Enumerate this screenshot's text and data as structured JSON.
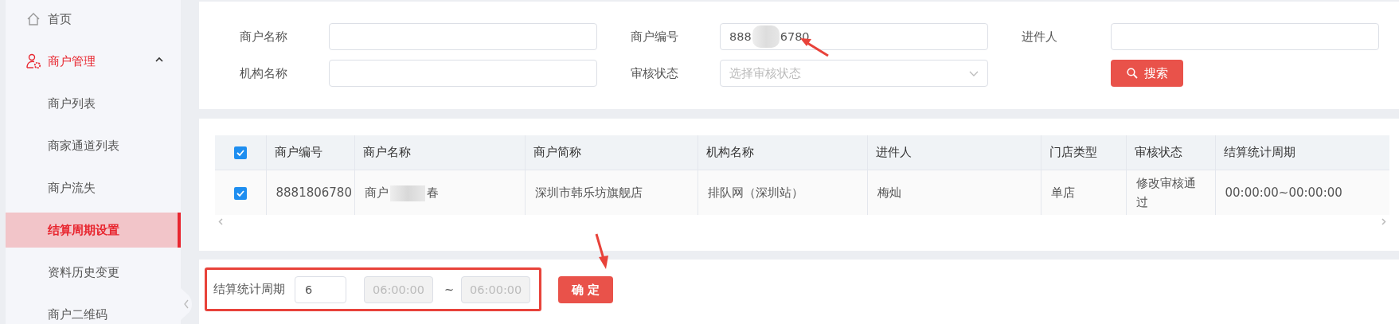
{
  "sidebar": {
    "items": [
      {
        "kind": "link",
        "label": "首页",
        "active": false
      },
      {
        "kind": "group",
        "label": "商户管理",
        "active": true,
        "expanded": true,
        "children": [
          {
            "label": "商户列表",
            "selected": false
          },
          {
            "label": "商家通道列表",
            "selected": false
          },
          {
            "label": "商户流失",
            "selected": false
          },
          {
            "label": "结算周期设置",
            "selected": true
          },
          {
            "label": "资料历史变更",
            "selected": false
          },
          {
            "label": "商户二维码",
            "selected": false
          }
        ]
      }
    ]
  },
  "search_form": {
    "fields": [
      {
        "kind": "text",
        "label": "商户名称"
      },
      {
        "kind": "text",
        "label": "商户编号",
        "value_parts": [
          "888",
          "6780"
        ]
      },
      {
        "kind": "text",
        "label": "进件人"
      },
      {
        "kind": "text",
        "label": "机构名称"
      },
      {
        "kind": "select",
        "label": "审核状态",
        "placeholder": "选择审核状态"
      },
      {
        "kind": "button",
        "label": "搜索"
      }
    ]
  },
  "table": {
    "all_checked": true,
    "columns": [
      "商户编号",
      "商户名称",
      "商户简称",
      "机构名称",
      "进件人",
      "门店类型",
      "审核状态",
      "结算统计周期"
    ],
    "rows": [
      {
        "checked": true,
        "cells": [
          "8881806780",
          [
            "商户",
            "春"
          ],
          "深圳市韩乐坊旗舰店",
          "排队网（深圳站）",
          "梅灿",
          "单店",
          "修改审核通过",
          "00:00:00~00:00:00"
        ]
      }
    ]
  },
  "period_form": {
    "label": "结算统计周期",
    "value": "6",
    "start": "06:00:00",
    "separator": "~",
    "end": "06:00:00",
    "times_disabled": true,
    "confirm_button": "确 定"
  }
}
